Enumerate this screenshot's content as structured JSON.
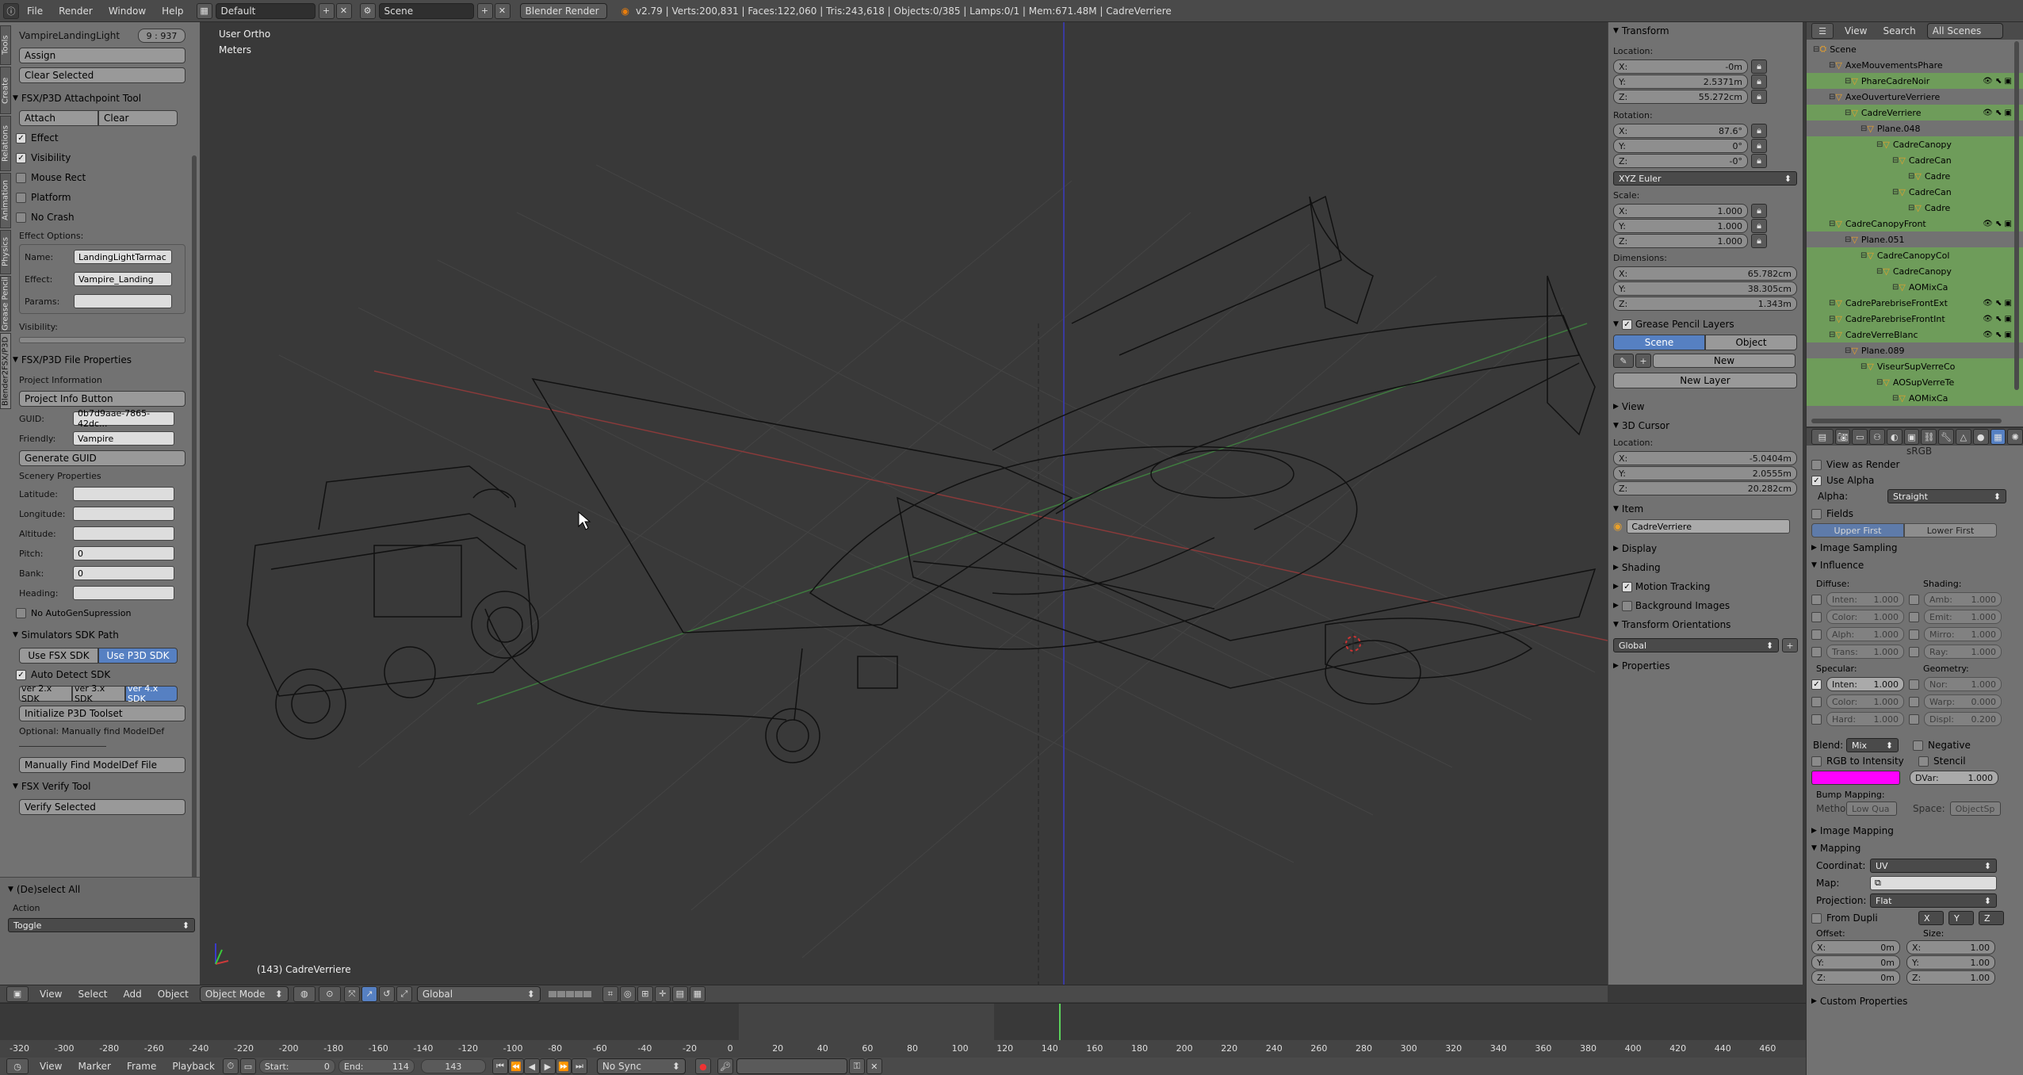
{
  "topbar": {
    "menu": [
      "File",
      "Render",
      "Window",
      "Help"
    ],
    "screen_layout": "Default",
    "scene": "Scene",
    "engine": "Blender Render",
    "stats": "v2.79 | Verts:200,831 | Faces:122,060 | Tris:243,618 | Objects:0/385 | Lamps:0/1 | Mem:671.48M | CadreVerriere"
  },
  "left_panel": {
    "tabs": [
      "Tools",
      "Create",
      "Relations",
      "Animation",
      "Physics",
      "Grease Pencil",
      "Blender2FSX/P3D"
    ],
    "light_name": "VampireLandingLight",
    "light_value": "9 : 937",
    "assign": "Assign",
    "clear_selected": "Clear Selected",
    "attach_header": "FSX/P3D Attachpoint Tool",
    "attach": "Attach",
    "clear": "Clear",
    "checks": [
      {
        "label": "Effect",
        "checked": true
      },
      {
        "label": "Visibility",
        "checked": true
      },
      {
        "label": "Mouse Rect",
        "checked": false
      },
      {
        "label": "Platform",
        "checked": false
      },
      {
        "label": "No Crash",
        "checked": false
      }
    ],
    "effect_options": "Effect Options:",
    "name_label": "Name:",
    "name_value": "LandingLightTarmac",
    "effect_label": "Effect:",
    "effect_value": "Vampire_Landing",
    "params_label": "Params:",
    "visibility_label": "Visibility:",
    "file_props_header": "FSX/P3D File Properties",
    "project_info": "Project Information",
    "project_info_button": "Project Info Button",
    "guid_label": "GUID:",
    "guid_value": "0b7d9aae-7865-42dc...",
    "friendly_label": "Friendly:",
    "friendly_value": "Vampire",
    "generate_guid": "Generate GUID",
    "scenery_props": "Scenery Properties",
    "scenery_fields": [
      {
        "label": "Latitude:",
        "value": ""
      },
      {
        "label": "Longitude:",
        "value": ""
      },
      {
        "label": "Altitude:",
        "value": ""
      },
      {
        "label": "Pitch:",
        "value": "0"
      },
      {
        "label": "Bank:",
        "value": "0"
      },
      {
        "label": "Heading:",
        "value": ""
      }
    ],
    "no_autogen": "No AutoGenSupression",
    "sdk_header": "Simulators SDK Path",
    "use_fsx_sdk": "Use FSX SDK",
    "use_p3d_sdk": "Use P3D SDK",
    "auto_detect": "Auto Detect SDK",
    "sdk_versions": [
      "ver 2.x SDK",
      "ver 3.x SDK",
      "ver 4.x SDK"
    ],
    "init_toolset": "Initialize P3D Toolset",
    "optional_text": "Optional: Manually find ModelDef",
    "manual_find": "Manually Find ModelDef File",
    "verify_header": "FSX Verify Tool",
    "verify_selected": "Verify Selected",
    "deselect_header": "(De)select All",
    "action_label": "Action",
    "action_value": "Toggle"
  },
  "viewport": {
    "view_label": "User Ortho",
    "units_label": "Meters",
    "object_label": "(143) CadreVerriere",
    "header": {
      "menus": [
        "View",
        "Select",
        "Add",
        "Object"
      ],
      "mode": "Object Mode",
      "orientation": "Global"
    }
  },
  "n_panel": {
    "transform_header": "Transform",
    "location_label": "Location:",
    "location": [
      {
        "axis": "X:",
        "value": "-0m"
      },
      {
        "axis": "Y:",
        "value": "2.5371m"
      },
      {
        "axis": "Z:",
        "value": "55.272cm"
      }
    ],
    "rotation_label": "Rotation:",
    "rotation": [
      {
        "axis": "X:",
        "value": "87.6°"
      },
      {
        "axis": "Y:",
        "value": "0°"
      },
      {
        "axis": "Z:",
        "value": "-0°"
      }
    ],
    "rotation_mode": "XYZ Euler",
    "scale_label": "Scale:",
    "scale": [
      {
        "axis": "X:",
        "value": "1.000"
      },
      {
        "axis": "Y:",
        "value": "1.000"
      },
      {
        "axis": "Z:",
        "value": "1.000"
      }
    ],
    "dimensions_label": "Dimensions:",
    "dimensions": [
      {
        "axis": "X:",
        "value": "65.782cm"
      },
      {
        "axis": "Y:",
        "value": "38.305cm"
      },
      {
        "axis": "Z:",
        "value": "1.343m"
      }
    ],
    "gp_header": "Grease Pencil Layers",
    "gp_scene": "Scene",
    "gp_object": "Object",
    "gp_new": "New",
    "gp_new_layer": "New Layer",
    "view_header": "View",
    "cursor_header": "3D Cursor",
    "cursor_location_label": "Location:",
    "cursor": [
      {
        "axis": "X:",
        "value": "-5.0404m"
      },
      {
        "axis": "Y:",
        "value": "2.0555m"
      },
      {
        "axis": "Z:",
        "value": "20.282cm"
      }
    ],
    "item_header": "Item",
    "item_name": "CadreVerriere",
    "display_header": "Display",
    "shading_header": "Shading",
    "motion_header": "Motion Tracking",
    "bg_header": "Background Images",
    "orient_header": "Transform Orientations",
    "orient_value": "Global",
    "props_header": "Properties"
  },
  "outliner": {
    "menus": [
      "View",
      "Search"
    ],
    "scope": "All Scenes",
    "items": [
      {
        "name": "Scene",
        "indent": 0,
        "hl": false
      },
      {
        "name": "AxeMouvementsPhare",
        "indent": 1,
        "hl": false
      },
      {
        "name": "PhareCadreNoir",
        "indent": 2,
        "hl": true
      },
      {
        "name": "AxeOuvertureVerriere",
        "indent": 1,
        "hl": false
      },
      {
        "name": "CadreVerriere",
        "indent": 2,
        "hl": true
      },
      {
        "name": "Plane.048",
        "indent": 3,
        "hl": false
      },
      {
        "name": "CadreCanopy",
        "indent": 4,
        "hl": true
      },
      {
        "name": "CadreCan",
        "indent": 5,
        "hl": true
      },
      {
        "name": "Cadre",
        "indent": 6,
        "hl": true
      },
      {
        "name": "CadreCan",
        "indent": 5,
        "hl": true
      },
      {
        "name": "Cadre",
        "indent": 6,
        "hl": true
      },
      {
        "name": "CadreCanopyFront",
        "indent": 1,
        "hl": true
      },
      {
        "name": "Plane.051",
        "indent": 2,
        "hl": false
      },
      {
        "name": "CadreCanopyCol",
        "indent": 3,
        "hl": true
      },
      {
        "name": "CadreCanopy",
        "indent": 4,
        "hl": true
      },
      {
        "name": "AOMixCa",
        "indent": 5,
        "hl": true
      },
      {
        "name": "CadreParebriseFrontExt",
        "indent": 1,
        "hl": true
      },
      {
        "name": "CadreParebriseFrontInt",
        "indent": 1,
        "hl": true
      },
      {
        "name": "CadreVerreBlanc",
        "indent": 1,
        "hl": true
      },
      {
        "name": "Plane.089",
        "indent": 2,
        "hl": false
      },
      {
        "name": "ViseurSupVerreCo",
        "indent": 3,
        "hl": true
      },
      {
        "name": "AOSupVerreTe",
        "indent": 4,
        "hl": true
      },
      {
        "name": "AOMixCa",
        "indent": 5,
        "hl": true
      }
    ]
  },
  "properties": {
    "color_space": "sRGB",
    "view_as_render": "View as Render",
    "use_alpha": "Use Alpha",
    "alpha_label": "Alpha:",
    "alpha_value": "Straight",
    "fields": "Fields",
    "upper_first": "Upper First",
    "lower_first": "Lower First",
    "image_sampling": "Image Sampling",
    "influence": "Influence",
    "diffuse_label": "Diffuse:",
    "shading_label": "Shading:",
    "diffuse": [
      {
        "name": "Inten:",
        "value": "1.000",
        "checked": false
      },
      {
        "name": "Color:",
        "value": "1.000",
        "checked": false
      },
      {
        "name": "Alph:",
        "value": "1.000",
        "checked": false
      },
      {
        "name": "Trans:",
        "value": "1.000",
        "checked": false
      }
    ],
    "shading": [
      {
        "name": "Amb:",
        "value": "1.000",
        "checked": false
      },
      {
        "name": "Emit:",
        "value": "1.000",
        "checked": false
      },
      {
        "name": "Mirro:",
        "value": "1.000",
        "checked": false
      },
      {
        "name": "Ray:",
        "value": "1.000",
        "checked": false
      }
    ],
    "specular_label": "Specular:",
    "geometry_label": "Geometry:",
    "specular": [
      {
        "name": "Inten:",
        "value": "1.000",
        "checked": true
      },
      {
        "name": "Color:",
        "value": "1.000",
        "checked": false
      },
      {
        "name": "Hard:",
        "value": "1.000",
        "checked": false
      }
    ],
    "geometry": [
      {
        "name": "Nor:",
        "value": "1.000",
        "checked": false
      },
      {
        "name": "Warp:",
        "value": "0.000",
        "checked": false
      },
      {
        "name": "Displ:",
        "value": "0.200",
        "checked": false
      }
    ],
    "blend_label": "Blend:",
    "blend_value": "Mix",
    "negative": "Negative",
    "rgb_intensity": "RGB to Intensity",
    "stencil": "Stencil",
    "swatch_color": "#ff00ff",
    "dvar_label": "DVar:",
    "dvar_value": "1.000",
    "bump_mapping": "Bump Mapping:",
    "method_label": "Metho:",
    "method_value": "Low Qua",
    "space_label": "Space:",
    "space_value": "ObjectSp",
    "image_mapping": "Image Mapping",
    "mapping": "Mapping",
    "coord_label": "Coordinat:",
    "coord_value": "UV",
    "map_label": "Map:",
    "projection_label": "Projection:",
    "projection_value": "Flat",
    "from_dupli": "From Dupli",
    "xyz": [
      "X",
      "Y",
      "Z"
    ],
    "offset_label": "Offset:",
    "size_label": "Size:",
    "offset": [
      {
        "axis": "X:",
        "value": "0m"
      },
      {
        "axis": "Y:",
        "value": "0m"
      },
      {
        "axis": "Z:",
        "value": "0m"
      }
    ],
    "size": [
      {
        "axis": "X:",
        "value": "1.00"
      },
      {
        "axis": "Y:",
        "value": "1.00"
      },
      {
        "axis": "Z:",
        "value": "1.00"
      }
    ],
    "custom_props": "Custom Properties"
  },
  "timeline": {
    "ticks": [
      "-320",
      "-300",
      "-280",
      "-260",
      "-240",
      "-220",
      "-200",
      "-180",
      "-160",
      "-140",
      "-120",
      "-100",
      "-80",
      "-60",
      "-40",
      "-20",
      "0",
      "20",
      "40",
      "60",
      "80",
      "100",
      "120",
      "140",
      "160",
      "180",
      "200",
      "220",
      "240",
      "260",
      "280",
      "300",
      "320",
      "340",
      "360",
      "380",
      "400",
      "420",
      "440",
      "460"
    ],
    "menus": [
      "View",
      "Marker",
      "Frame",
      "Playback"
    ],
    "start_label": "Start:",
    "start": "0",
    "end_label": "End:",
    "end": "114",
    "current": "143",
    "sync": "No Sync"
  }
}
